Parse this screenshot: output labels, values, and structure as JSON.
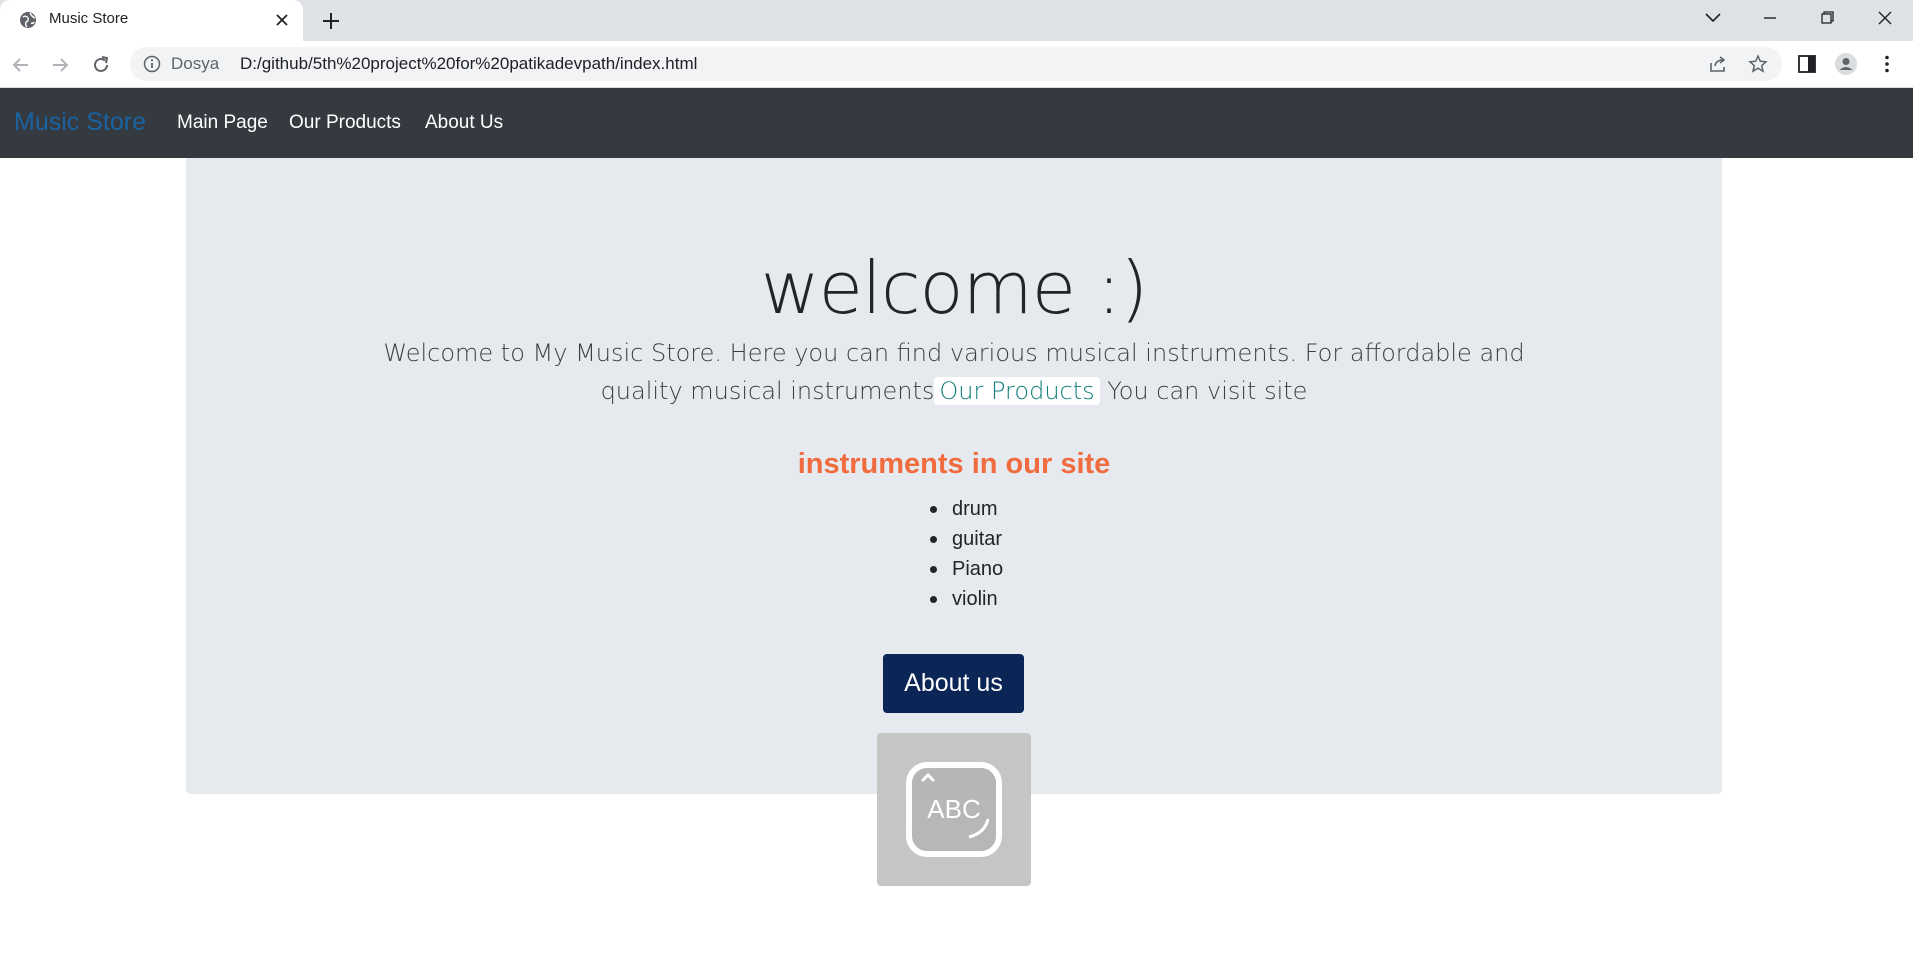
{
  "browser": {
    "tab_title": "Music Store",
    "omnibox_host": "Dosya",
    "omnibox_url": "D:/github/5th%20project%20for%20patikadevpath/index.html"
  },
  "navbar": {
    "brand": "Music Store",
    "links": [
      "Main Page",
      "Our Products",
      "About Us"
    ]
  },
  "hero": {
    "title": "welcome :)",
    "lead_before": "Welcome to My Music Store. Here you can find various musical instruments. For affordable and quality musical instruments",
    "lead_link": "Our Products",
    "lead_after": " You can visit site",
    "instruments_title": "instruments in our site",
    "instruments": [
      "drum",
      "guitar",
      "Piano",
      "violin"
    ],
    "about_button": "About us"
  },
  "overlay": {
    "label": "ABC"
  },
  "colors": {
    "navbar_bg": "#343a40",
    "jumbotron_bg": "#e6e9ed",
    "brand": "#1769b3",
    "instruments_title": "#f06b3e",
    "button_bg": "#0a2556",
    "link": "#0f7e7a"
  }
}
